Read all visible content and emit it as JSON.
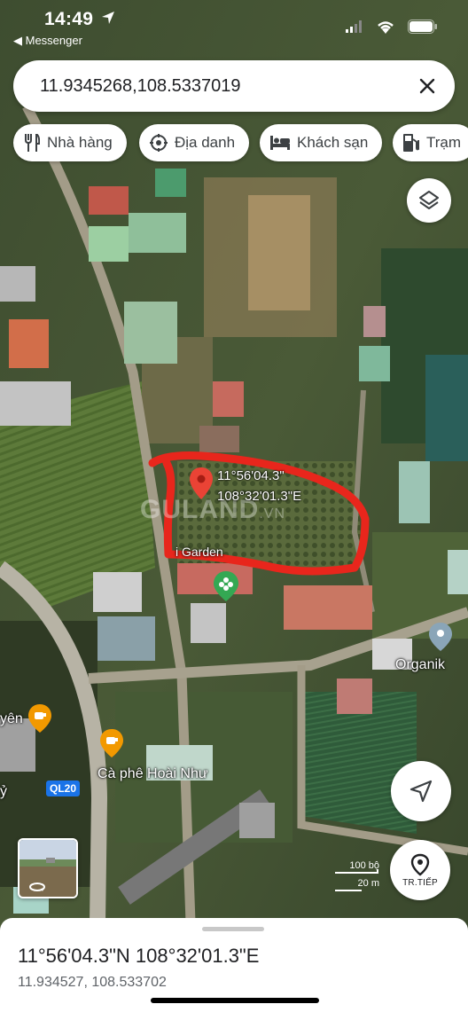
{
  "status_bar": {
    "time": "14:49",
    "back_app": "◀ Messenger"
  },
  "search": {
    "value": "11.9345268,108.5337019"
  },
  "chips": [
    {
      "label": "Nhà hàng",
      "icon": "fork-knife-icon"
    },
    {
      "label": "Địa danh",
      "icon": "landmark-icon"
    },
    {
      "label": "Khách sạn",
      "icon": "bed-icon"
    },
    {
      "label": "Trạm",
      "icon": "gas-station-icon"
    }
  ],
  "pin": {
    "lat_dms": "11°56'04.3\"",
    "lng_dms": "108°32'01.3\"E"
  },
  "map_labels": {
    "organik": "Organik",
    "cafe": "Cà phê Hoài Như",
    "garden": "i Garden",
    "left_fragment_1": "yên",
    "left_fragment_2": "ỷ",
    "route": "QL20",
    "watermark_main": "GULAND",
    "watermark_suffix": ".VN"
  },
  "scale": {
    "top": "100 bộ",
    "bottom": "20 m"
  },
  "directions": {
    "label": "TR.TIẾP"
  },
  "place": {
    "title": "11°56'04.3\"N 108°32'01.3\"E",
    "decimal": "11.934527, 108.533702"
  },
  "colors": {
    "pin": "#ea4335",
    "annotation": "#e8261c",
    "route_badge": "#1a73e8",
    "cafe_marker": "#f29900",
    "garden_marker": "#34a853"
  }
}
